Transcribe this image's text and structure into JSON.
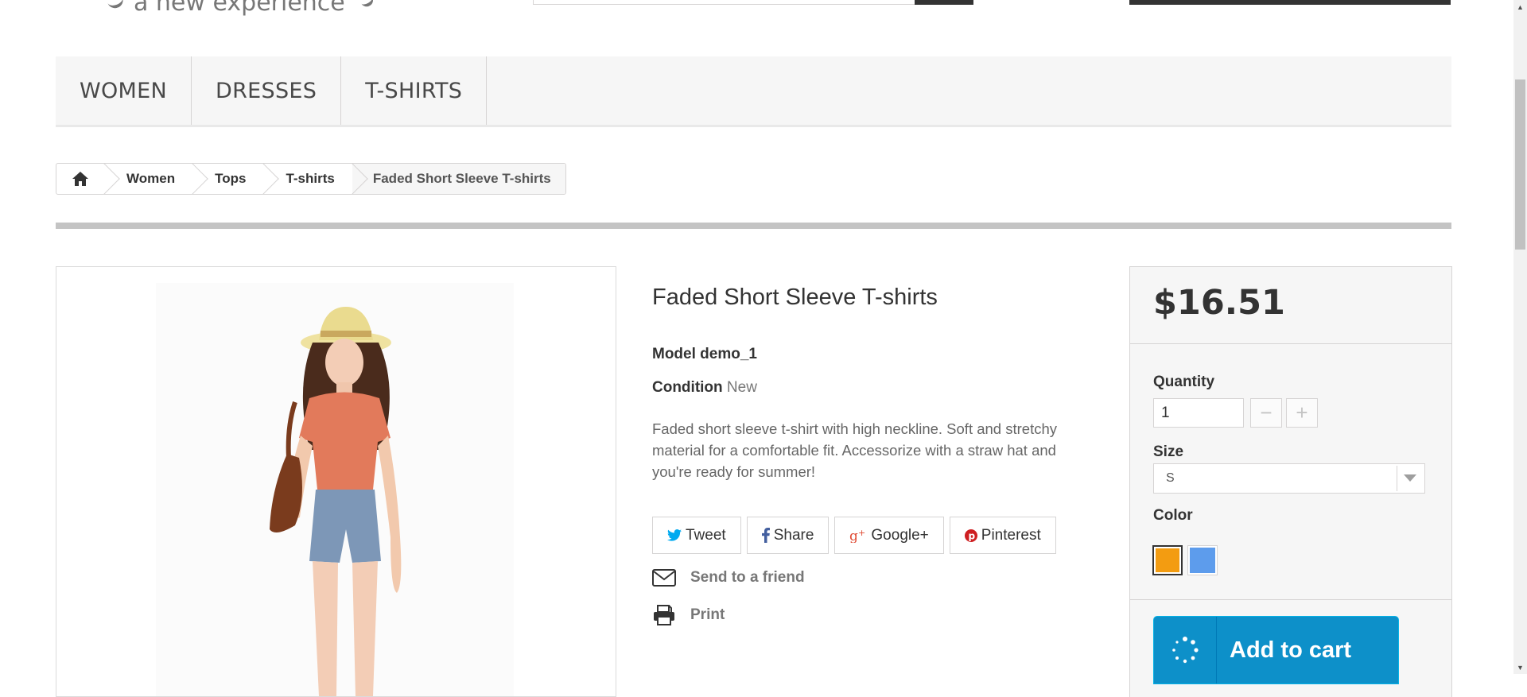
{
  "header": {
    "logo_tagline": "a new experience"
  },
  "menu": {
    "items": [
      {
        "label": "WOMEN"
      },
      {
        "label": "DRESSES"
      },
      {
        "label": "T-SHIRTS"
      }
    ]
  },
  "breadcrumb": {
    "home_icon": "home-icon",
    "items": [
      "Women",
      "Tops",
      "T-shirts"
    ],
    "current": "Faded Short Sleeve T-shirts"
  },
  "product": {
    "title": "Faded Short Sleeve T-shirts",
    "model_label": "Model",
    "model_value": "demo_1",
    "condition_label": "Condition",
    "condition_value": "New",
    "description": "Faded short sleeve t-shirt with high neckline. Soft and stretchy material for a comfortable fit. Accessorize with a straw hat and you're ready for summer!"
  },
  "social": {
    "tweet": "Tweet",
    "share": "Share",
    "googleplus": "Google+",
    "pinterest": "Pinterest"
  },
  "links": {
    "send_friend": "Send to a friend",
    "print": "Print"
  },
  "buybox": {
    "price": "$16.51",
    "quantity_label": "Quantity",
    "quantity_value": "1",
    "size_label": "Size",
    "size_value": "S",
    "color_label": "Color",
    "colors": [
      "#f39c11",
      "#5d9cec"
    ],
    "add_to_cart": "Add to cart"
  },
  "colors": {
    "accent_blue": "#0d90c9",
    "menu_bg": "#f6f6f6",
    "twitter": "#00aaf0",
    "facebook": "#435f9f",
    "googleplus": "#e04b34",
    "pinterest": "#ce1f21"
  }
}
